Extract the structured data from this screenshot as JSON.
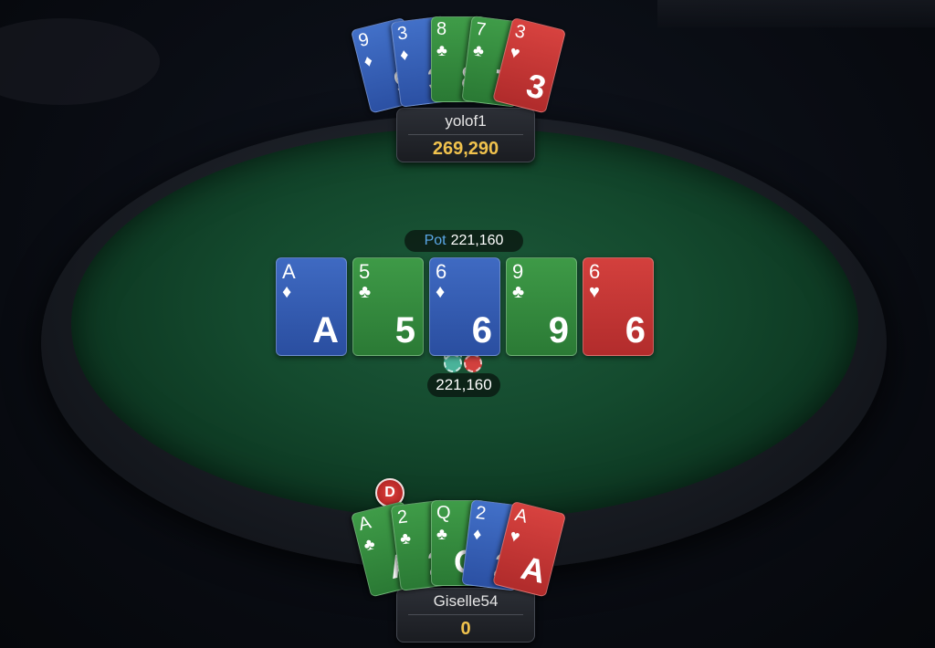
{
  "colors": {
    "felt": "#144a2e",
    "blue_card": "#2a4ea0",
    "green_card": "#2b7a35",
    "red_card": "#b22c2c",
    "stack_gold": "#f0c24d",
    "pot_blue": "#5aa7e6"
  },
  "top_player": {
    "name": "yolof1",
    "stack": "269,290",
    "cards": [
      {
        "rank": "9",
        "suit": "♦",
        "color": "blue"
      },
      {
        "rank": "3",
        "suit": "♦",
        "color": "blue"
      },
      {
        "rank": "8",
        "suit": "♣",
        "color": "green"
      },
      {
        "rank": "7",
        "suit": "♣",
        "color": "green"
      },
      {
        "rank": "3",
        "suit": "♥",
        "color": "red"
      }
    ]
  },
  "pot": {
    "label": "Pot",
    "amount": "221,160"
  },
  "board": [
    {
      "rank": "A",
      "suit": "♦",
      "color": "blue"
    },
    {
      "rank": "5",
      "suit": "♣",
      "color": "green"
    },
    {
      "rank": "6",
      "suit": "♦",
      "color": "blue"
    },
    {
      "rank": "9",
      "suit": "♣",
      "color": "green"
    },
    {
      "rank": "6",
      "suit": "♥",
      "color": "red"
    }
  ],
  "bet": {
    "amount": "221,160"
  },
  "dealer_button": {
    "label": "D"
  },
  "bottom_player": {
    "name": "Giselle54",
    "stack": "0",
    "cards": [
      {
        "rank": "A",
        "suit": "♣",
        "color": "green"
      },
      {
        "rank": "2",
        "suit": "♣",
        "color": "green"
      },
      {
        "rank": "Q",
        "suit": "♣",
        "color": "green"
      },
      {
        "rank": "2",
        "suit": "♦",
        "color": "blue"
      },
      {
        "rank": "A",
        "suit": "♥",
        "color": "red"
      }
    ]
  }
}
